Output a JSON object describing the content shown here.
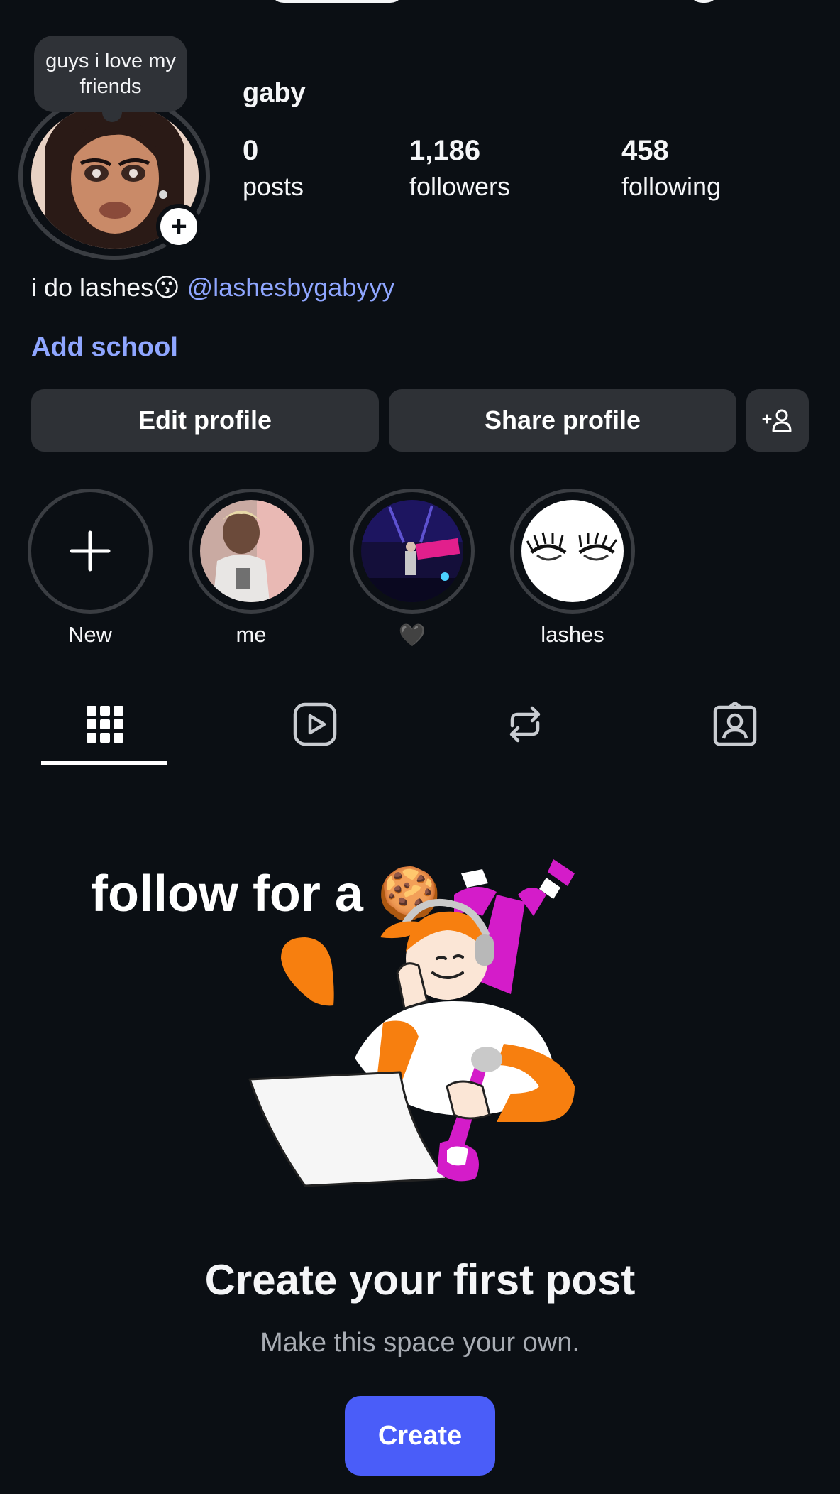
{
  "profile": {
    "username": "gaby",
    "note": "guys i love my friends",
    "stats": [
      {
        "value": "0",
        "label": "posts"
      },
      {
        "value": "1,186",
        "label": "followers"
      },
      {
        "value": "458",
        "label": "following"
      }
    ],
    "bio_text": "i do lashes😗",
    "bio_link": "@lashesbygabyyy",
    "add_school": "Add school"
  },
  "actions": {
    "edit_profile": "Edit profile",
    "share_profile": "Share profile",
    "add_person_icon": "add-person-icon"
  },
  "highlights": [
    {
      "label": "New",
      "icon": "plus-icon"
    },
    {
      "label": "me"
    },
    {
      "label": "🖤"
    },
    {
      "label": "lashes"
    }
  ],
  "tabs": [
    {
      "icon": "grid-icon",
      "selected": true
    },
    {
      "icon": "reels-icon",
      "selected": false
    },
    {
      "icon": "repost-icon",
      "selected": false
    },
    {
      "icon": "tagged-icon",
      "selected": false
    }
  ],
  "overlay_caption": "follow for a 🍪",
  "empty_state": {
    "title": "Create your first post",
    "subtitle": "Make this space your own.",
    "create_label": "Create"
  },
  "colors": {
    "background": "#0b0f14",
    "link": "#8fa6ff",
    "button": "#2e3136",
    "primary": "#4a5df9",
    "illustration_orange": "#f77f0f",
    "illustration_magenta": "#d41cc9"
  }
}
